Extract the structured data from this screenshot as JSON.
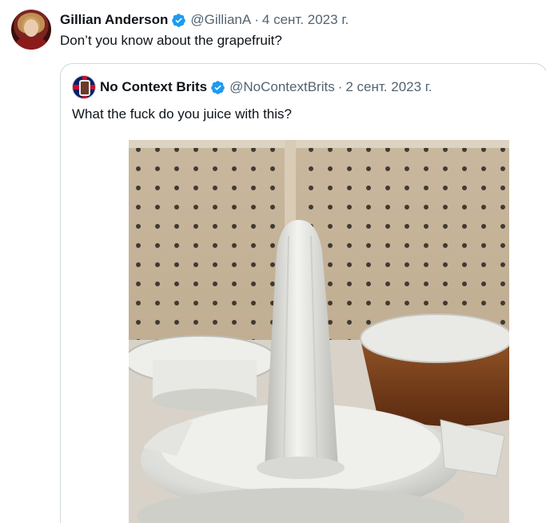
{
  "tweet": {
    "author_name": "Gillian Anderson",
    "author_handle": "@GillianA",
    "separator": "·",
    "date": "4 сент. 2023 г.",
    "text": "Don’t you know about the grapefruit?",
    "avatar_icon": "profile-photo",
    "verified_icon": "verified-badge-icon"
  },
  "quoted_tweet": {
    "author_name": "No Context Brits",
    "author_handle": "@NoContextBrits",
    "separator": "·",
    "date": "2 сент. 2023 г.",
    "text": "What the fuck do you juice with this?",
    "avatar_icon": "union-jack-avatar",
    "verified_icon": "verified-badge-icon",
    "media": "photo of a white ceramic juicer on a pegboard store shelf"
  },
  "colors": {
    "text_primary": "#0f1419",
    "text_secondary": "#536471",
    "verified": "#1d9bf0",
    "border": "#cfd9de"
  }
}
